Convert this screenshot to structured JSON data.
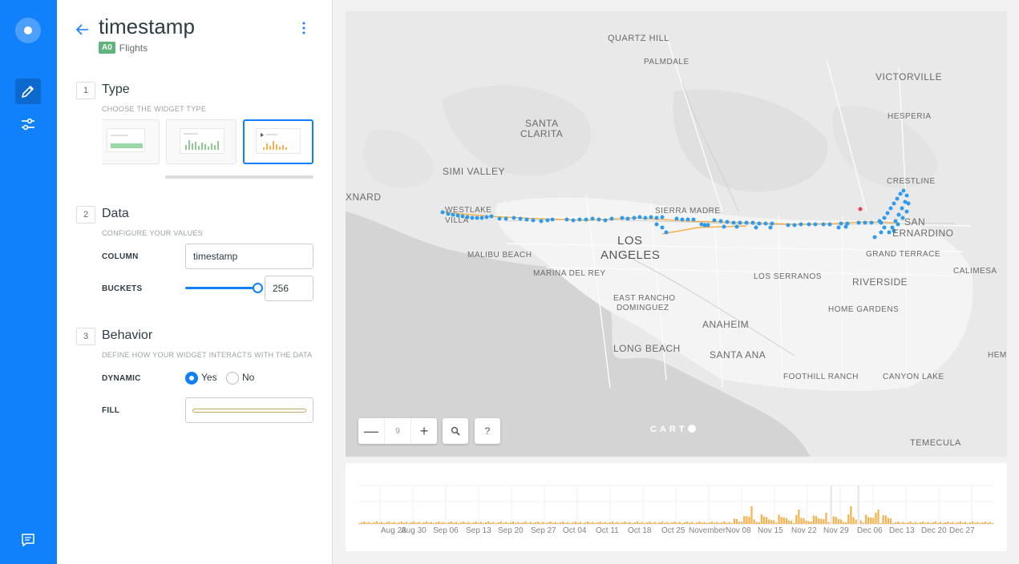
{
  "colors": {
    "brand": "#1181fb",
    "accent_fill": "#f4b14d",
    "points": "#2d9cf0",
    "outlier": "#f03e56"
  },
  "nav": {
    "items": [
      {
        "icon": "logo-icon"
      },
      {
        "icon": "pencil-icon",
        "active": true
      },
      {
        "icon": "sliders-icon"
      },
      {
        "icon": "chat-icon"
      }
    ]
  },
  "header": {
    "title": "timestamp",
    "layer_chip": "A0",
    "dataset": "Flights"
  },
  "sections": {
    "type": {
      "num": "1",
      "title": "Type",
      "subtitle": "CHOOSE THE WIDGET TYPE"
    },
    "data": {
      "num": "2",
      "title": "Data",
      "subtitle": "CONFIGURE YOUR VALUES"
    },
    "behavior": {
      "num": "3",
      "title": "Behavior",
      "subtitle": "DEFINE HOW YOUR WIDGET INTERACTS WITH THE DATA"
    }
  },
  "fields": {
    "column_label": "COLUMN",
    "column_value": "timestamp",
    "buckets_label": "BUCKETS",
    "buckets_value": "256",
    "buckets_slider_fraction": 1.0,
    "dynamic_label": "DYNAMIC",
    "dynamic_yes": "Yes",
    "dynamic_no": "No",
    "dynamic_selected": "Yes",
    "fill_label": "FILL"
  },
  "map": {
    "zoom_level": "9",
    "zoom_out": "—",
    "zoom_in": "+",
    "help": "?",
    "attribution": "CART",
    "labels": [
      {
        "text": "QUARTZ HILL"
      },
      {
        "text": "PALMDALE"
      },
      {
        "text": "VICTORVILLE"
      },
      {
        "text": "HESPERIA"
      },
      {
        "text": "SANTA"
      },
      {
        "text": "CLARITA"
      },
      {
        "text": "CRESTLINE"
      },
      {
        "text": "SIMI VALLEY"
      },
      {
        "text": "XNARD"
      },
      {
        "text": "SIERRA MADRE"
      },
      {
        "text": "LOS"
      },
      {
        "text": "ANGELES"
      },
      {
        "text": "SAN"
      },
      {
        "text": "ERNARDINO"
      },
      {
        "text": "MALIBU BEACH"
      },
      {
        "text": "GRAND TERRACE"
      },
      {
        "text": "MARINA DEL REY"
      },
      {
        "text": "LOS SERRANOS"
      },
      {
        "text": "RIVERSIDE"
      },
      {
        "text": "CALIMESA"
      },
      {
        "text": "EAST RANCHO"
      },
      {
        "text": "DOMINGUEZ"
      },
      {
        "text": "HOME GARDENS"
      },
      {
        "text": "ANAHEIM"
      },
      {
        "text": "LONG BEACH"
      },
      {
        "text": "SANTA ANA"
      },
      {
        "text": "HEMI"
      },
      {
        "text": "FOOTHILL RANCH"
      },
      {
        "text": "CANYON LAKE"
      },
      {
        "text": "TEMECULA"
      },
      {
        "text": "WESTLAKE"
      },
      {
        "text": "VILLA"
      }
    ]
  },
  "timeline": {
    "ticks": [
      "Aug 23",
      "Aug 30",
      "Sep 06",
      "Sep 13",
      "Sep 20",
      "Sep 27",
      "Oct 04",
      "Oct 11",
      "Oct 18",
      "Oct 25",
      "November",
      "Nov 08",
      "Nov 15",
      "Nov 22",
      "Nov 29",
      "Dec 06",
      "Dec 13",
      "Dec 20",
      "Dec 27"
    ]
  }
}
